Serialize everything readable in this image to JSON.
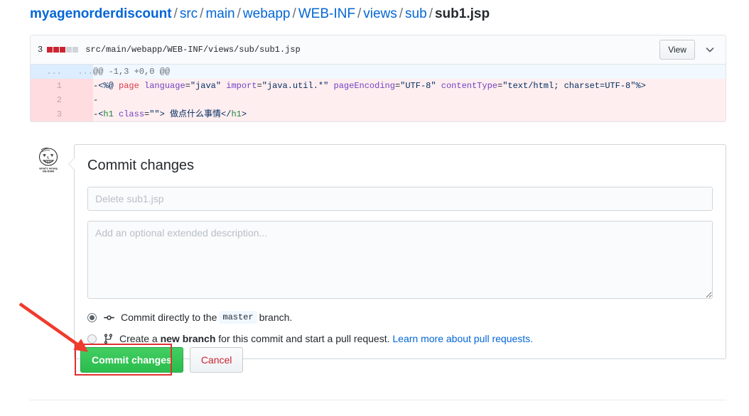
{
  "breadcrumb": {
    "repo": "myagenorderdiscount",
    "parts": [
      "src",
      "main",
      "webapp",
      "WEB-INF",
      "views",
      "sub"
    ],
    "current": "sub1.jsp",
    "separator": "/"
  },
  "diff": {
    "changed_count": "3",
    "path": "src/main/webapp/WEB-INF/views/sub/sub1.jsp",
    "view_label": "View",
    "expand_icon": "chevron-down-icon",
    "stat_blocks": [
      "del",
      "del",
      "del",
      "neutral",
      "neutral"
    ],
    "hunk": {
      "old_gutter": "...",
      "new_gutter": "...",
      "header": "@@ -1,3 +0,0 @@"
    },
    "lines": [
      {
        "number": "1",
        "marker": "-",
        "text": "<%@ page language=\"java\" import=\"java.util.*\" pageEncoding=\"UTF-8\" contentType=\"text/html; charset=UTF-8\"%>"
      },
      {
        "number": "2",
        "marker": "-",
        "text": ""
      },
      {
        "number": "3",
        "marker": "-",
        "text": "<h1 class=\"\"> 做点什么事情</h1>"
      }
    ]
  },
  "commit_form": {
    "avatar": "user-avatar-cartoon-face",
    "title": "Commit changes",
    "summary_placeholder": "Delete sub1.jsp",
    "summary_value": "",
    "description_placeholder": "Add an optional extended description...",
    "description_value": "",
    "options": [
      {
        "selected": true,
        "icon": "git-commit-icon",
        "text_before": "Commit directly to the",
        "branch": "master",
        "text_after": "branch."
      },
      {
        "selected": false,
        "icon": "git-branch-icon",
        "text_before": "Create a",
        "emphasis": "new branch",
        "text_after": "for this commit and start a pull request.",
        "link": "Learn more about pull requests."
      }
    ],
    "commit_button": "Commit changes",
    "cancel_button": "Cancel"
  },
  "annotations": {
    "arrow": "red-arrow-pointing-to-commit-button",
    "highlight_box": "red-rectangle-around-commit-button",
    "color": "#e03030"
  },
  "colors": {
    "link": "#0366d6",
    "commit_green": "#2cbe4e",
    "cancel_red": "#cb2431",
    "deletion_bg": "#ffeef0",
    "deletion_gutter": "#ffdce0",
    "hunk_bg": "#f1f8ff"
  }
}
